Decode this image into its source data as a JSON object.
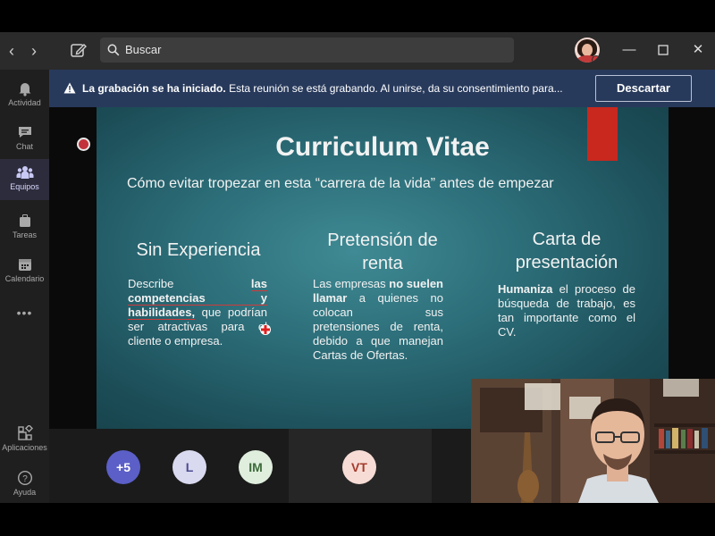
{
  "titlebar": {
    "search_placeholder": "Buscar"
  },
  "rail": {
    "items": [
      {
        "label": "Actividad",
        "icon": "bell-icon"
      },
      {
        "label": "Chat",
        "icon": "chat-icon"
      },
      {
        "label": "Equipos",
        "icon": "teams-icon"
      },
      {
        "label": "Tareas",
        "icon": "tasks-icon"
      },
      {
        "label": "Calendario",
        "icon": "calendar-icon"
      },
      {
        "label": "Aplicaciones",
        "icon": "apps-icon"
      },
      {
        "label": "Ayuda",
        "icon": "help-icon"
      }
    ],
    "more": "•••"
  },
  "banner": {
    "bold": "La grabación se ha iniciado.",
    "text": "Esta reunión se está grabando. Al unirse, da su consentimiento para...",
    "dismiss_label": "Descartar"
  },
  "slide": {
    "title": "Curriculum Vitae",
    "subtitle": "Cómo evitar tropezar en esta “carrera de la vida” antes de empezar",
    "col1": {
      "heading": "Sin Experiencia",
      "t1": "Describe ",
      "b1": "las competencias y habilidades,",
      "t2": " que podrían ser atractivas para el cliente o empresa."
    },
    "col2": {
      "heading": "Pretensión de renta",
      "t1": "Las empresas ",
      "b1": "no suelen llamar",
      "t2": " a quienes no colocan sus pretensiones de renta, debido a que manejan Cartas de Ofertas."
    },
    "col3": {
      "heading": "Carta de presentación",
      "b1": "Humaniza",
      "t2": " el proceso de búsqueda de trabajo, es tan importante como el CV."
    },
    "accent_color": "#c8281e"
  },
  "participants": [
    {
      "initials": "+5",
      "bg": "#5b5fc7",
      "fg": "#ffffff"
    },
    {
      "initials": "L",
      "bg": "#d9d9f0",
      "fg": "#4b4b8f"
    },
    {
      "initials": "IM",
      "bg": "#dfeedd",
      "fg": "#3d6b3a"
    },
    {
      "initials": "VT",
      "bg": "#f7dcd6",
      "fg": "#a33b2c"
    }
  ]
}
